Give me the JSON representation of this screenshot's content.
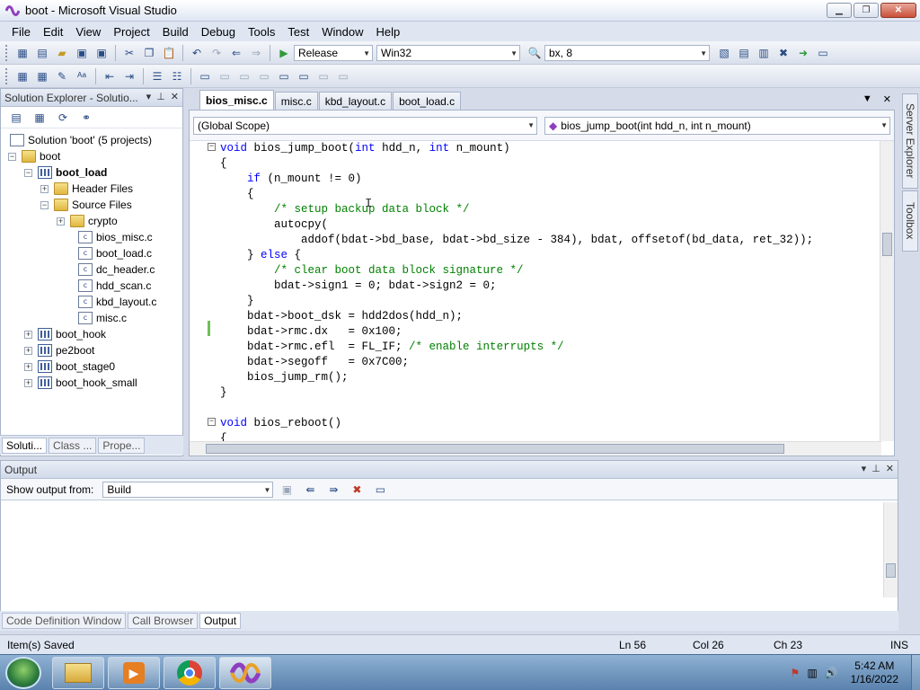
{
  "window": {
    "title": "boot - Microsoft Visual Studio"
  },
  "menu": [
    "File",
    "Edit",
    "View",
    "Project",
    "Build",
    "Debug",
    "Tools",
    "Test",
    "Window",
    "Help"
  ],
  "toolbar": {
    "config": "Release",
    "platform": "Win32",
    "find": "bx, 8"
  },
  "solution_explorer": {
    "title": "Solution Explorer - Solutio...",
    "tree": [
      {
        "label": "Solution 'boot' (5 projects)"
      },
      {
        "label": "boot"
      },
      {
        "label": "boot_load"
      },
      {
        "label": "Header Files"
      },
      {
        "label": "Source Files"
      },
      {
        "label": "crypto"
      },
      {
        "label": "bios_misc.c"
      },
      {
        "label": "boot_load.c"
      },
      {
        "label": "dc_header.c"
      },
      {
        "label": "hdd_scan.c"
      },
      {
        "label": "kbd_layout.c"
      },
      {
        "label": "misc.c"
      },
      {
        "label": "boot_hook"
      },
      {
        "label": "pe2boot"
      },
      {
        "label": "boot_stage0"
      },
      {
        "label": "boot_hook_small"
      }
    ],
    "tabs": [
      "Soluti...",
      "Class ...",
      "Prope..."
    ]
  },
  "editor": {
    "tabs": [
      "bios_misc.c",
      "misc.c",
      "kbd_layout.c",
      "boot_load.c"
    ],
    "scope": "(Global Scope)",
    "function": "bios_jump_boot(int hdd_n, int n_mount)",
    "code": [
      "void bios_jump_boot(int hdd_n, int n_mount)",
      "{",
      "    if (n_mount != 0)",
      "    {",
      "        /* setup backup data block */",
      "        autocpy(",
      "            addof(bdat->bd_base, bdat->bd_size - 384), bdat, offsetof(bd_data, ret_32));",
      "    } else {",
      "        /* clear boot data block signature */",
      "        bdat->sign1 = 0; bdat->sign2 = 0;",
      "    }",
      "    bdat->boot_dsk = hdd2dos(hdd_n);",
      "    bdat->rmc.dx   = 0x100;",
      "    bdat->rmc.efl  = FL_IF; /* enable interrupts */",
      "    bdat->segoff   = 0x7C00;",
      "    bios_jump_rm();",
      "}",
      "",
      "void bios_reboot()",
      "{"
    ]
  },
  "side_tabs": [
    "Server Explorer",
    "Toolbox"
  ],
  "output": {
    "title": "Output",
    "show_label": "Show output from:",
    "source": "Build",
    "tabs": [
      "Code Definition Window",
      "Call Browser",
      "Output"
    ]
  },
  "status": {
    "text": "Item(s) Saved",
    "ln": "Ln 56",
    "col": "Col 26",
    "ch": "Ch 23",
    "mode": "INS"
  },
  "clock": {
    "time": "5:42 AM",
    "date": "1/16/2022"
  }
}
